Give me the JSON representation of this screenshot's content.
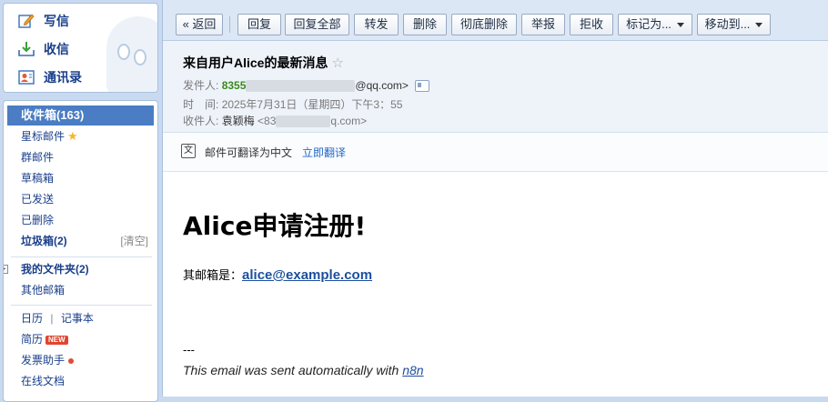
{
  "top_actions": [
    {
      "label": "写信",
      "icon": "compose-icon"
    },
    {
      "label": "收信",
      "icon": "inbox-download-icon"
    },
    {
      "label": "通讯录",
      "icon": "contacts-icon"
    }
  ],
  "folders": {
    "inbox": "收件箱(163)",
    "starred": "星标邮件",
    "group": "群邮件",
    "drafts": "草稿箱",
    "sent": "已发送",
    "deleted": "已删除",
    "spam": "垃圾箱(2)",
    "spam_clear": "[清空]",
    "my_folders": "我的文件夹(2)",
    "other_mailbox": "其他邮箱",
    "calendar": "日历",
    "calendar_sep": "|",
    "notebook": "记事本",
    "resume": "简历",
    "resume_badge": "NEW",
    "invoice": "发票助手",
    "online_docs": "在线文档"
  },
  "toolbar": {
    "back": "« 返回",
    "reply": "回复",
    "reply_all": "回复全部",
    "forward": "转发",
    "delete": "删除",
    "delete_permanent": "彻底删除",
    "report": "举报",
    "reject": "拒收",
    "mark_as": "标记为...",
    "move_to": "移动到..."
  },
  "header": {
    "subject": "来自用户Alice的最新消息",
    "sender_label": "发件人:",
    "sender_prefix": "8355",
    "sender_suffix": "@qq.com>",
    "time_label": "时　间:",
    "time_value": "2025年7月31日（星期四）下午3：55",
    "recipient_label": "收件人:",
    "recipient_name": "袁颖梅",
    "recipient_prefix": "<83",
    "recipient_suffix": "q.com>"
  },
  "translate": {
    "text": "邮件可翻译为中文",
    "link": "立即翻译"
  },
  "body": {
    "heading": "Alice申请注册!",
    "email_label": "其邮箱是：",
    "email_value": "alice@example.com",
    "dashes": "---",
    "footer_text": "This email was sent automatically with ",
    "footer_link": "n8n"
  },
  "colors": {
    "accent": "#4a7dc4",
    "link": "#1c4f9e",
    "sender_green": "#3a8a1c",
    "background": "#c9daf0"
  }
}
